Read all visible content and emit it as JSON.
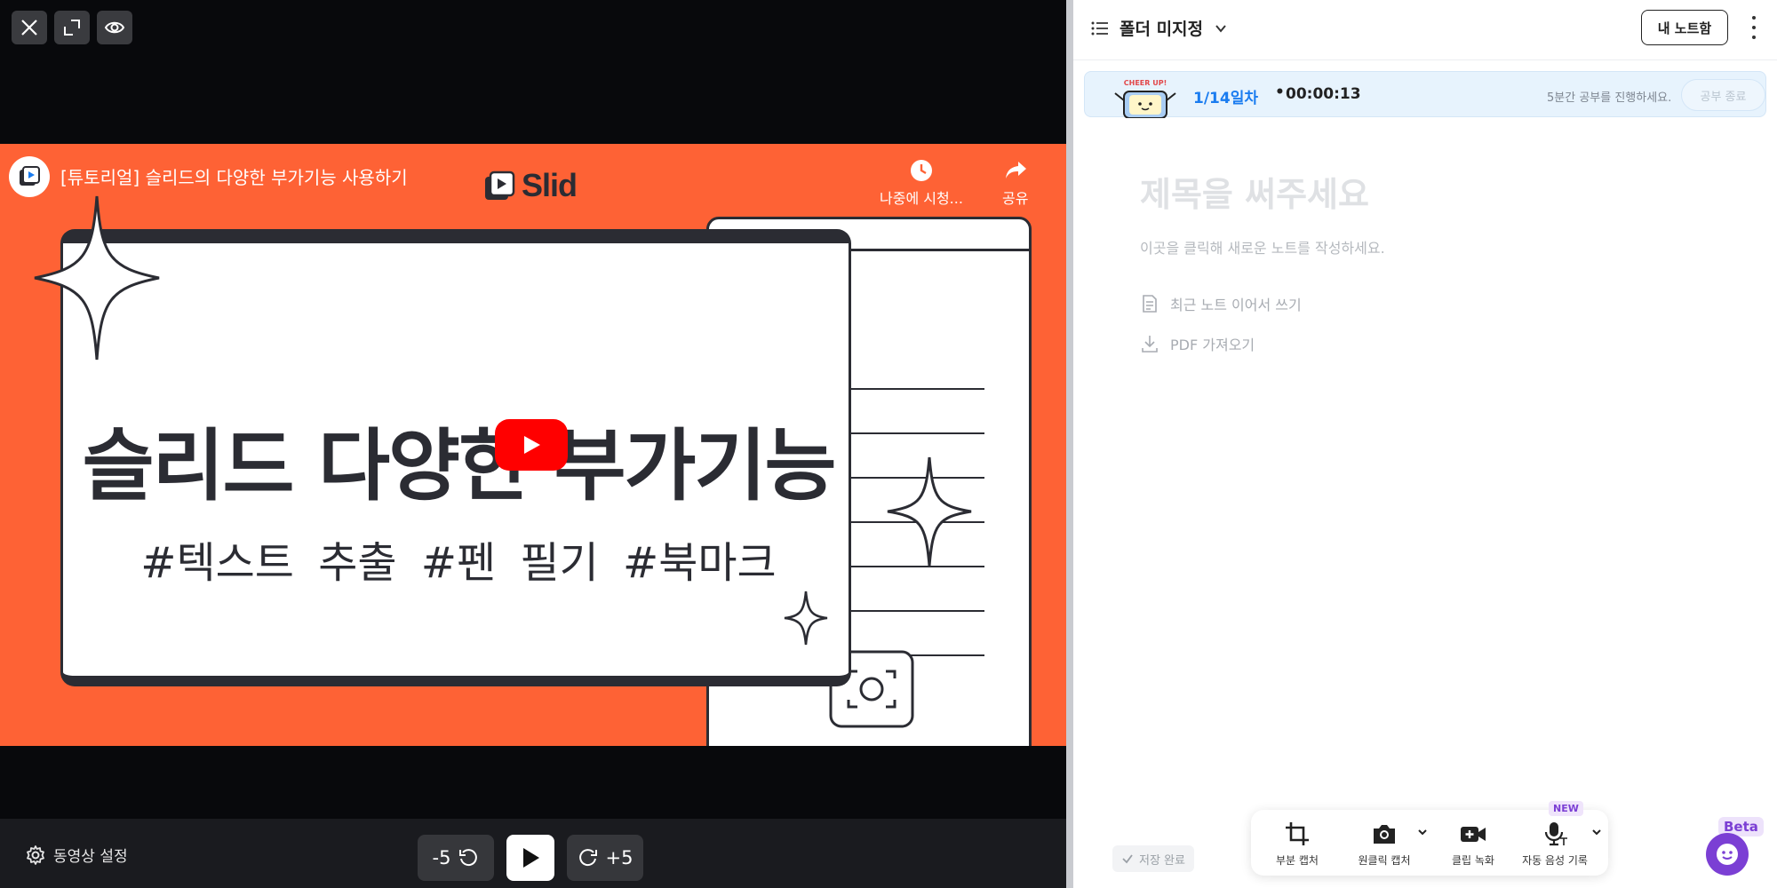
{
  "video": {
    "title": "[튜토리얼] 슬리드의 다양한 부가기능 사용하기",
    "brand_logo": "Slid",
    "watch_later_label": "나중에 시청...",
    "share_label": "공유",
    "thumbnail_title": "슬리드 다양한 부가기능",
    "thumbnail_tags": "#텍스트 추출  #펜 필기  #북마크",
    "thumbnail_bg_color": "#fe6235"
  },
  "controls": {
    "settings_label": "동영상 설정",
    "rewind_label": "-5",
    "forward_label": "+5"
  },
  "note": {
    "folder_label": "폴더 미지정",
    "my_notes_label": "내 노트함",
    "study": {
      "day": "1/14일차",
      "separator": "•",
      "time": "00:00:13",
      "hint": "5분간 공부를 진행하세요.",
      "end_button": "공부 종료",
      "sticker_text": "CHEER UP!"
    },
    "title_placeholder": "제목을 써주세요",
    "body_hint": "이곳을 클릭해 새로운 노트를 작성하세요.",
    "actions": [
      {
        "label": "최근 노트 이어서 쓰기"
      },
      {
        "label": "PDF 가져오기"
      }
    ],
    "save_status": "저장 완료"
  },
  "toolbar": {
    "items": [
      {
        "label": "부분 캡처"
      },
      {
        "label": "원클릭 캡처"
      },
      {
        "label": "클립 녹화"
      },
      {
        "label": "자동 음성 기록"
      }
    ],
    "new_badge": "NEW"
  },
  "chat": {
    "beta_label": "Beta"
  },
  "colors": {
    "accent_blue": "#1a7cf0",
    "accent_purple": "#7b3fd4",
    "youtube_red": "#ff0000"
  }
}
